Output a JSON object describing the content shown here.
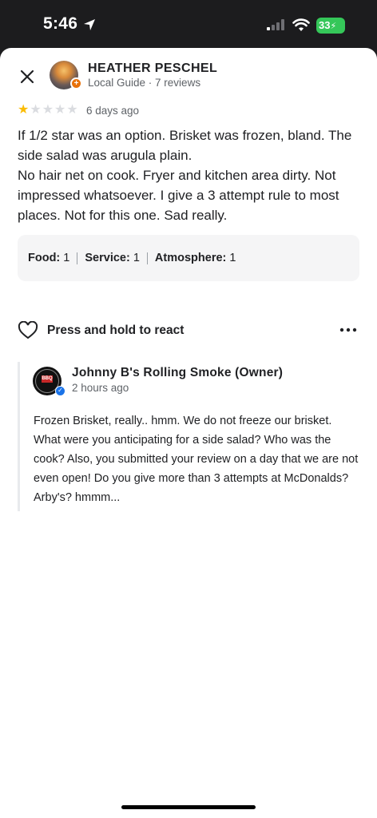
{
  "status_bar": {
    "time": "5:46",
    "battery": "33"
  },
  "reviewer": {
    "name": "HEATHER PESCHEL",
    "meta": "Local Guide · 7 reviews"
  },
  "review": {
    "rating": 1,
    "max_rating": 5,
    "date": "6 days ago",
    "text": "If 1/2 star was an option. Brisket was frozen, bland. The side salad was arugula plain.\nNo hair net on cook. Fryer and kitchen area dirty. Not impressed whatsoever. I give a 3 attempt rule to most places. Not for this one. Sad really."
  },
  "ratings": [
    {
      "label": "Food:",
      "value": "1"
    },
    {
      "label": "Service:",
      "value": "1"
    },
    {
      "label": "Atmosphere:",
      "value": "1"
    }
  ],
  "react": {
    "label": "Press and hold to react"
  },
  "owner_reply": {
    "name": "Johnny B's Rolling Smoke (Owner)",
    "time": "2 hours ago",
    "avatar_text": "BBQ",
    "text": "Frozen Brisket, really.. hmm. We do not freeze our brisket. What were you anticipating for a side salad? Who was the cook? Also, you submitted your review on a day that we are not even open! Do you give more than 3 attempts at McDonalds? Arby's? hmmm..."
  },
  "colors": {
    "star_filled": "#fbbc04",
    "star_empty": "#dadce0",
    "badge_orange": "#e8710a",
    "verified_blue": "#1a73e8",
    "battery_green": "#35c759"
  },
  "icons": [
    "location-arrow-icon",
    "signal-icon",
    "wifi-icon",
    "battery-icon",
    "close-icon",
    "heart-icon",
    "more-icon",
    "verified-icon"
  ]
}
